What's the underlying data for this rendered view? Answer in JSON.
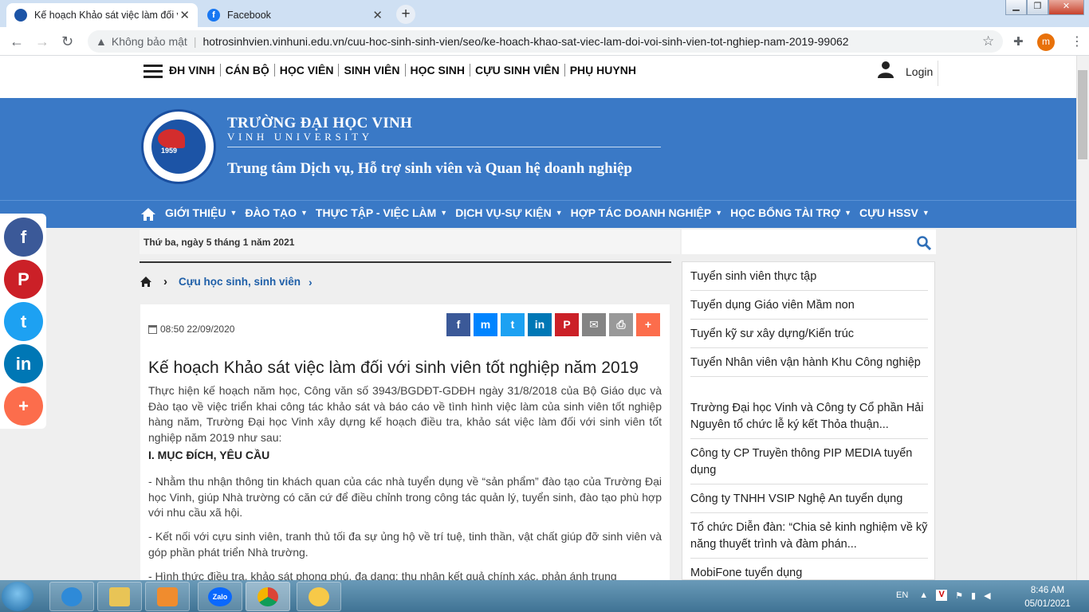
{
  "browser": {
    "tabs": [
      {
        "title": "Kế hoạch Khảo sát việc làm đối v",
        "active": true
      },
      {
        "title": "Facebook",
        "active": false
      }
    ],
    "new_tab": "+",
    "security_label": "Không bảo mật",
    "url": "hotrosinhvien.vinhuni.edu.vn/cuu-hoc-sinh-sinh-vien/seo/ke-hoach-khao-sat-viec-lam-doi-voi-sinh-vien-tot-nghiep-nam-2019-99062",
    "profile_initial": "m"
  },
  "topnav": {
    "items": [
      "ĐH VINH",
      "CÁN BỘ",
      "HỌC VIÊN",
      "SINH VIÊN",
      "HỌC SINH",
      "CỰU SINH VIÊN",
      "PHỤ HUYNH"
    ],
    "login": "Login"
  },
  "banner": {
    "logo_year": "1959",
    "university_vi": "TRƯỜNG ĐẠI HỌC VINH",
    "university_en": "VINH UNIVERSITY",
    "center_name": "Trung tâm Dịch vụ, Hỗ trợ sinh viên và Quan hệ doanh nghiệp"
  },
  "mainnav": {
    "items": [
      "GIỚI THIỆU",
      "ĐÀO TẠO",
      "THỰC TẬP - VIỆC LÀM",
      "DỊCH VỤ-SỰ KIỆN",
      "HỢP TÁC DOANH NGHIỆP",
      "HỌC BỔNG TÀI TRỢ",
      "CỰU HSSV"
    ]
  },
  "date_text": "Thứ ba, ngày 5 tháng 1 năm 2021",
  "breadcrumb": {
    "section": "Cựu học sinh, sinh viên"
  },
  "article": {
    "timestamp": "08:50 22/09/2020",
    "title": "Kế hoạch Khảo sát việc làm đối với sinh viên tốt nghiệp năm 2019",
    "intro": "Thực hiện kế hoạch năm học, Công văn số 3943/BGDĐT-GDĐH ngày 31/8/2018 của Bộ Giáo dục và Đào tạo về việc triển khai công tác khảo sát và báo cáo về tình hình việc làm của sinh viên tốt nghiệp hàng năm, Trường Đại học Vinh xây dựng kế hoạch điều tra, khảo sát việc làm đối với sinh viên tốt nghiệp năm 2019 như sau:",
    "section_heading": "I. MỤC ĐÍCH, YÊU CẦU",
    "bullets": [
      "- Nhằm thu nhận thông tin khách quan của các nhà tuyển dụng về “sản phẩm” đào tạo của Trường Đại học Vinh, giúp Nhà trường có căn cứ để điều chỉnh trong công tác quản lý, tuyển sinh, đào tạo phù hợp với nhu cầu xã hội.",
      "- Kết nối với cựu sinh viên, tranh thủ tối đa sự ủng hộ về trí tuệ, tinh thần, vật chất giúp đỡ sinh viên và góp phần phát triển Nhà trường.",
      "- Hình thức điều tra, khảo sát phong phú, đa dạng; thu nhận kết quả chính xác, phản ánh trung"
    ]
  },
  "share_buttons": [
    {
      "icon": "facebook-icon",
      "glyph": "f",
      "color": "#3b5998"
    },
    {
      "icon": "messenger-icon",
      "glyph": "m",
      "color": "#0084ff"
    },
    {
      "icon": "twitter-icon",
      "glyph": "t",
      "color": "#1da1f2"
    },
    {
      "icon": "linkedin-icon",
      "glyph": "in",
      "color": "#0077b5"
    },
    {
      "icon": "pinterest-icon",
      "glyph": "P",
      "color": "#cb2027"
    },
    {
      "icon": "email-icon",
      "glyph": "✉",
      "color": "#848484"
    },
    {
      "icon": "print-icon",
      "glyph": "⎙",
      "color": "#999999"
    },
    {
      "icon": "more-icon",
      "glyph": "+",
      "color": "#fc6d4c"
    }
  ],
  "sidebar": {
    "items": [
      "Tuyển sinh viên thực tập",
      "Tuyển dụng Giáo viên Mầm non",
      "Tuyển kỹ sư xây dựng/Kiến trúc",
      "Tuyển Nhân viên vận hành Khu Công nghiệp",
      "Trường Đại học Vinh và Công ty Cổ phần Hải Nguyên tổ chức lễ ký kết Thỏa thuận...",
      "Công ty CP Truyền thông PIP MEDIA tuyển dụng",
      "Công ty TNHH VSIP Nghệ An tuyển dụng",
      "Tổ chức Diễn đàn: “Chia sẻ kinh nghiệm về kỹ năng thuyết trình và đàm phán...",
      "MobiFone tuyển dụng"
    ]
  },
  "social_float": [
    {
      "icon": "facebook-icon",
      "glyph": "f",
      "color": "#3b5998"
    },
    {
      "icon": "pinterest-icon",
      "glyph": "P",
      "color": "#cb2027"
    },
    {
      "icon": "twitter-icon",
      "glyph": "t",
      "color": "#1da1f2"
    },
    {
      "icon": "linkedin-icon",
      "glyph": "in",
      "color": "#0077b5"
    },
    {
      "icon": "more-icon",
      "glyph": "+",
      "color": "#fc6d4c"
    }
  ],
  "taskbar": {
    "apps": [
      "internet-explorer-icon",
      "file-explorer-icon",
      "media-player-icon",
      "zalo-icon",
      "chrome-icon",
      "app-icon"
    ],
    "zalo_label": "Zalo",
    "language": "EN",
    "time": "8:46 AM",
    "date": "05/01/2021"
  },
  "colors": {
    "brand_blue": "#3a79c6",
    "link_blue": "#1f5fa8"
  }
}
